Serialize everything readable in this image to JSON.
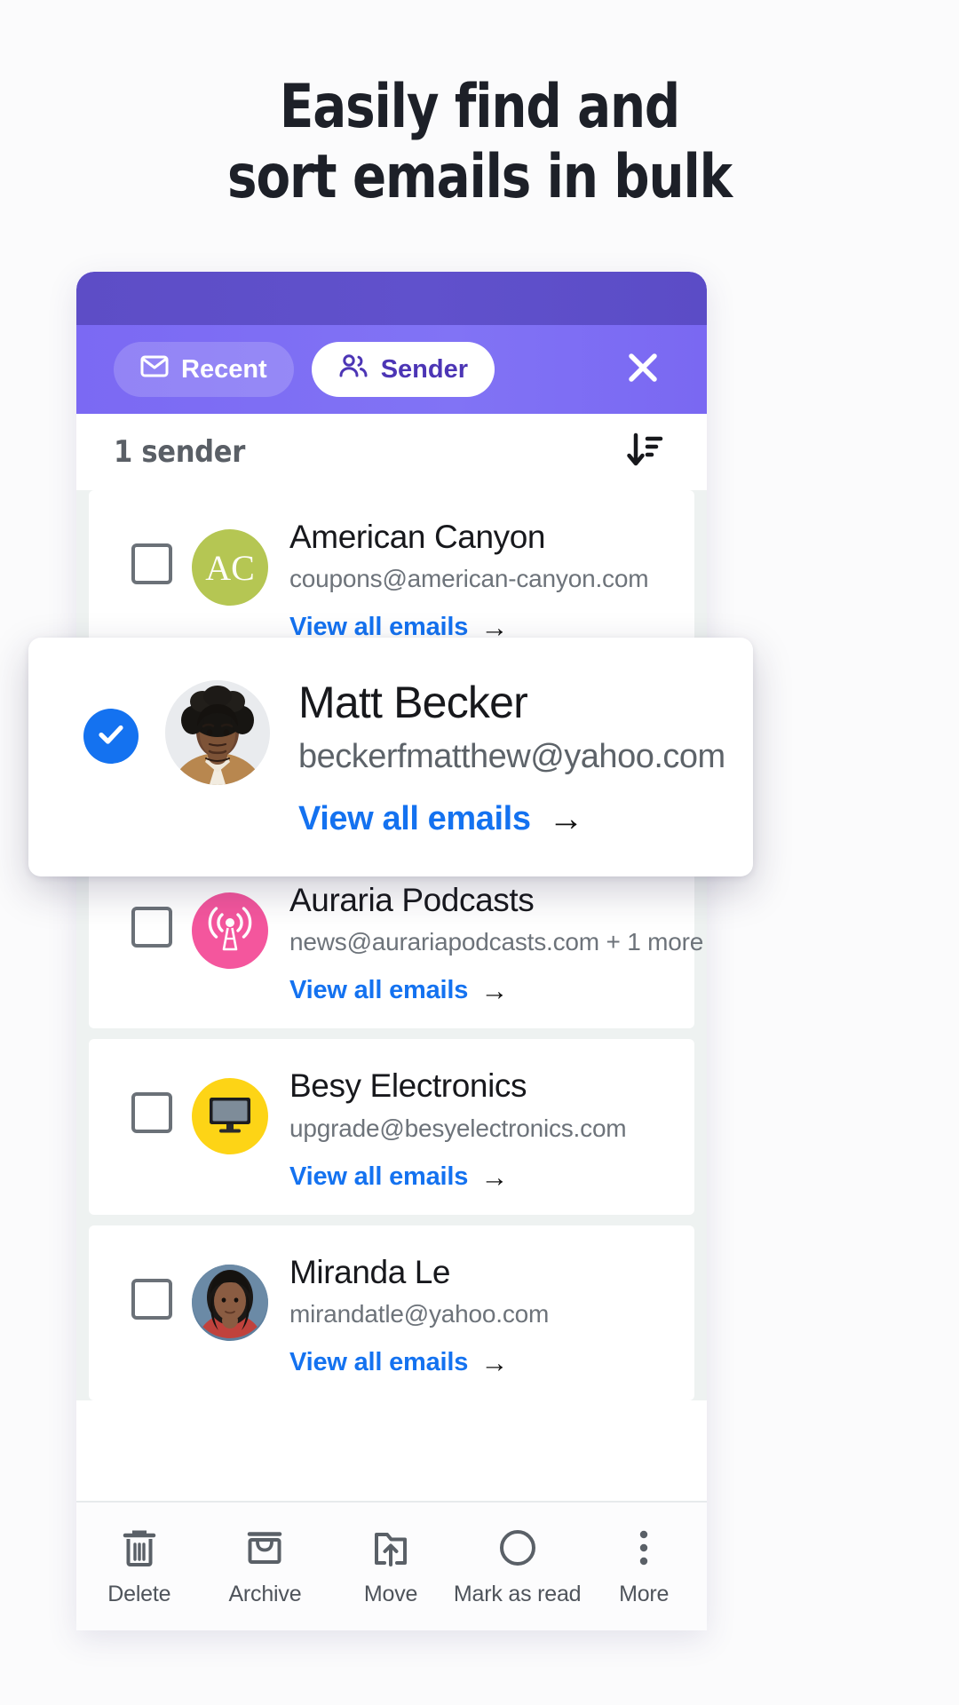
{
  "headline": {
    "line1": "Easily find and",
    "line2": "sort emails in bulk"
  },
  "app": {
    "header": {
      "tabs": [
        {
          "label": "Recent",
          "icon": "envelope-icon",
          "active": false
        },
        {
          "label": "Sender",
          "icon": "people-icon",
          "active": true
        }
      ],
      "close_icon": "close-icon",
      "colors": {
        "status_strip": "#5d4dc6",
        "header_bar": "#7d6cf2",
        "active_tab_text": "#4c35b5"
      }
    },
    "count_row": {
      "label": "1 sender",
      "sort_icon": "sort-descending-icon"
    },
    "senders": [
      {
        "name": "American Canyon",
        "email": "coupons@american-canyon.com",
        "link": "View all emails",
        "selected": false,
        "avatar_type": "initials",
        "avatar_text": "AC",
        "avatar_color": "#b5c653"
      },
      {
        "name": "Auraria Podcasts",
        "email": "news@aurariapodcasts.com + 1 more",
        "link": "View all emails",
        "selected": false,
        "avatar_type": "broadcast-icon",
        "avatar_text": "",
        "avatar_color": "#f4569d"
      },
      {
        "name": "Besy Electronics",
        "email": "upgrade@besyelectronics.com",
        "link": "View all emails",
        "selected": false,
        "avatar_type": "monitor-icon",
        "avatar_text": "",
        "avatar_color": "#fdd416"
      },
      {
        "name": "Miranda Le",
        "email": "mirandatle@yahoo.com",
        "link": "View all emails",
        "selected": false,
        "avatar_type": "photo",
        "avatar_text": "",
        "avatar_color": "#5d7f9e"
      }
    ],
    "highlighted_sender": {
      "name": "Matt Becker",
      "email": "beckerfmatthew@yahoo.com",
      "link": "View all emails",
      "selected": true,
      "avatar_type": "photo",
      "check_color": "#1472f0",
      "link_color": "#1472f0"
    },
    "toolbar": [
      {
        "label": "Delete",
        "icon": "trash-icon"
      },
      {
        "label": "Archive",
        "icon": "archive-icon"
      },
      {
        "label": "Move",
        "icon": "move-folder-icon"
      },
      {
        "label": "Mark as read",
        "icon": "circle-icon"
      },
      {
        "label": "More",
        "icon": "more-vertical-icon"
      }
    ]
  }
}
